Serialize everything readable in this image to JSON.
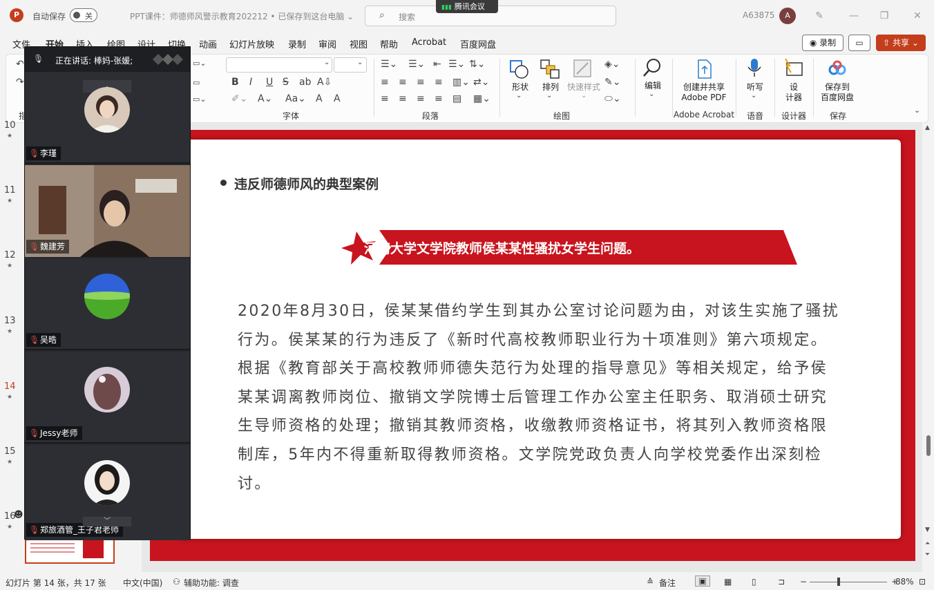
{
  "titlebar": {
    "autosave_label": "自动保存",
    "autosave_state": "关",
    "doc_title": "PPT课件：师德师风警示教育202212 • 已保存到这台电脑 ⌄",
    "search_placeholder": "搜索",
    "meeting_app": "腾讯会议",
    "user_id": "A63875",
    "avatar_letter": "A"
  },
  "menu": {
    "tabs": [
      "文件",
      "开始",
      "插入",
      "绘图",
      "设计",
      "切换",
      "动画",
      "幻灯片放映",
      "录制",
      "审阅",
      "视图",
      "帮助",
      "Acrobat",
      "百度网盘"
    ],
    "record_label": "录制",
    "share_label": "共享"
  },
  "ribbon": {
    "groups": {
      "font": "字体",
      "paragraph": "段落",
      "drawing": "绘图",
      "acrobat": "Adobe Acrobat",
      "voice": "语音",
      "designer": "设计器",
      "save": "保存"
    },
    "buttons": {
      "shape": "形状",
      "arrange": "排列",
      "quick_style": "快速样式",
      "edit": "编辑",
      "create_share_pdf_1": "创建并共享",
      "create_share_pdf_2": "Adobe PDF",
      "dictate": "听写",
      "designer_1": "设",
      "designer_2": "计器",
      "save_baidu_1": "保存到",
      "save_baidu_2": "百度网盘"
    },
    "left_clip": "指"
  },
  "thumbnails": {
    "numbers": [
      "10",
      "11",
      "12",
      "13",
      "14",
      "15",
      "16"
    ],
    "current": "14"
  },
  "slide": {
    "heading": "违反师德师风的典型案例",
    "banner": "河南大学文学院教师侯某某性骚扰女学生问题。",
    "body_lines": [
      "2020年8月30日，侯某某借约学生到其办公室讨论问题为由，对该生实施了骚扰",
      "行为。侯某某的行为违反了《新时代高校教师职业行为十项准则》第六项规定。",
      "根据《教育部关于高校教师师德失范行为处理的指导意见》等相关规定，给予侯",
      "某某调离教师岗位、撤销文学院博士后管理工作办公室主任职务、取消硕士研究",
      "生导师资格的处理；撤销其教师资格，收缴教师资格证书，将其列入教师资格限",
      "制库，5年内不得重新取得教师资格。文学院党政负责人向学校党委作出深刻检",
      "讨。"
    ]
  },
  "meeting": {
    "speaking": "正在讲话: 棒妈-张媛;",
    "participants": [
      "李瑾",
      "魏建芳",
      "吴晧",
      "Jessy老师",
      "郑旅酒管_王子君老师"
    ]
  },
  "status": {
    "slide_info": "幻灯片 第 14 张，共 17 张",
    "language": "中文(中国)",
    "accessibility": "辅助功能: 调查",
    "notes": "备注",
    "zoom": "88%"
  },
  "colors": {
    "brand": "#c43e1c",
    "slide_red": "#c8141e"
  }
}
